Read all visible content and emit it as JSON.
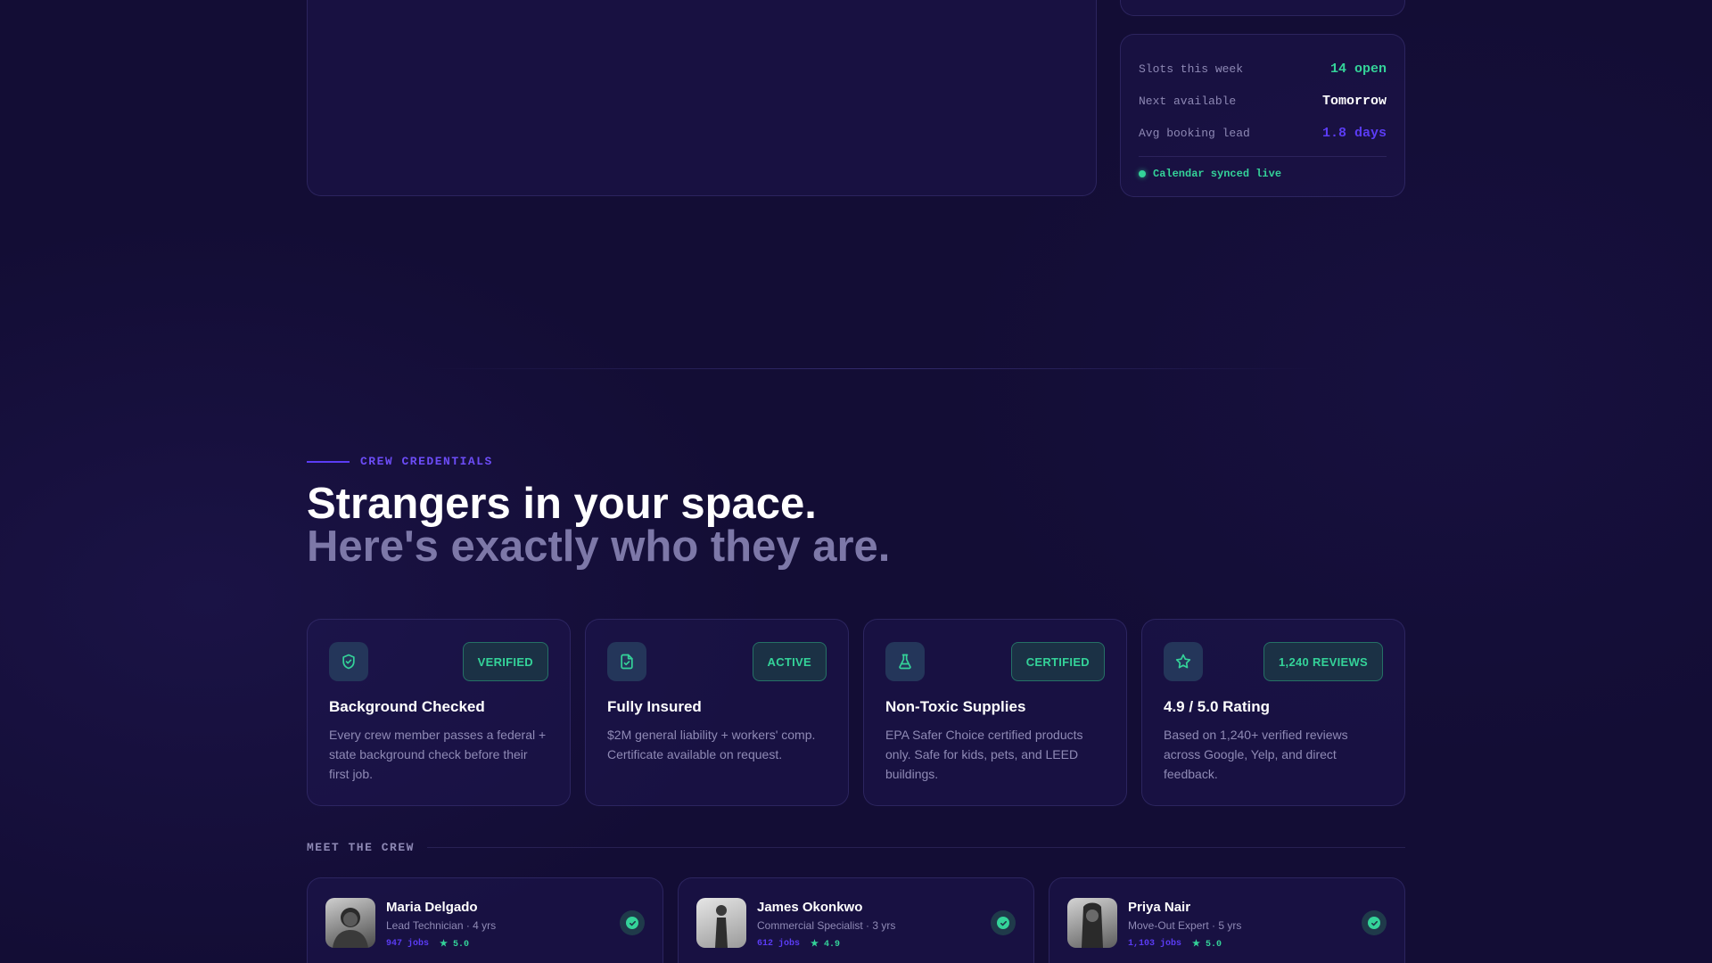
{
  "colors": {
    "accent_green": "#34d399",
    "accent_purple": "#6c4cf7",
    "text_white": "#ffffff",
    "text_muted": "#8d88b4"
  },
  "availability": {
    "rows": [
      {
        "label": "Slots this week",
        "value": "14 open",
        "color": "#34d399"
      },
      {
        "label": "Next available",
        "value": "Tomorrow",
        "color": "#ffffff"
      },
      {
        "label": "Avg booking lead",
        "value": "1.8 days",
        "color": "#5b3cf5"
      }
    ],
    "live_status": "Calendar synced live"
  },
  "credentials": {
    "eyebrow": "CREW CREDENTIALS",
    "headline": "Strangers in your space.",
    "subheadline": "Here's exactly who they are.",
    "cards": [
      {
        "icon": "shield-check-icon",
        "badge": "VERIFIED",
        "title": "Background Checked",
        "desc": "Every crew member passes a federal + state background check before their first job."
      },
      {
        "icon": "document-check-icon",
        "badge": "ACTIVE",
        "title": "Fully Insured",
        "desc": "$2M general liability + workers' comp. Certificate available on request."
      },
      {
        "icon": "flask-icon",
        "badge": "CERTIFIED",
        "title": "Non-Toxic Supplies",
        "desc": "EPA Safer Choice certified products only. Safe for kids, pets, and LEED buildings."
      },
      {
        "icon": "star-icon",
        "badge": "1,240 REVIEWS",
        "title": "4.9 / 5.0 Rating",
        "desc": "Based on 1,240+ verified reviews across Google, Yelp, and direct feedback."
      }
    ]
  },
  "crew": {
    "header": "MEET THE CREW",
    "members": [
      {
        "name": "Maria Delgado",
        "role": "Lead Technician · 4 yrs",
        "jobs": "947 jobs",
        "rating": "★ 5.0"
      },
      {
        "name": "James Okonkwo",
        "role": "Commercial Specialist · 3 yrs",
        "jobs": "612 jobs",
        "rating": "★ 4.9"
      },
      {
        "name": "Priya Nair",
        "role": "Move-Out Expert · 5 yrs",
        "jobs": "1,103 jobs",
        "rating": "★ 5.0"
      }
    ]
  }
}
